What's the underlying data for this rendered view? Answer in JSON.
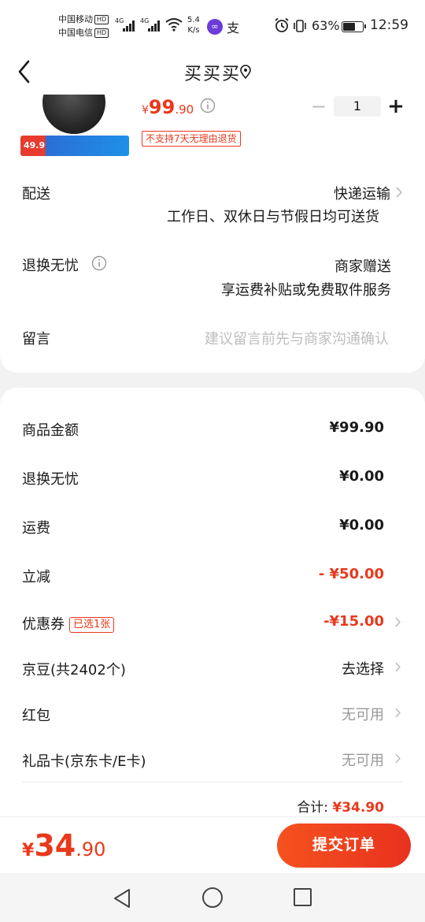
{
  "status_bar": {
    "carrier1": "中国移动",
    "carrier2": "中国电信",
    "hd": "HD",
    "net": "4G",
    "speed_value": "5.4",
    "speed_unit": "K/s",
    "battery": "63%",
    "time": "12:59",
    "battery_level_percent": 63
  },
  "header": {
    "title": "买买买"
  },
  "product": {
    "banner_price": "49.9",
    "price_symbol": "¥",
    "price_int": "99",
    "price_dec": ".90",
    "quantity": "1",
    "minus": "−",
    "plus": "+",
    "no_return_tag": "不支持7天无理由退货"
  },
  "delivery": {
    "label": "配送",
    "method": "快递运输",
    "note": "工作日、双休日与节假日均可送货"
  },
  "return_worry_free": {
    "label": "退换无忧",
    "value": "商家赠送",
    "note": "享运费补贴或免费取件服务"
  },
  "message": {
    "label": "留言",
    "placeholder": "建议留言前先与商家沟通确认"
  },
  "fees": {
    "goods_amount_label": "商品金额",
    "goods_amount": "¥99.90",
    "return_label": "退换无忧",
    "return_amount": "¥0.00",
    "shipping_label": "运费",
    "shipping_amount": "¥0.00",
    "discount_label": "立减",
    "discount_amount": "- ¥50.00",
    "coupon_label": "优惠券",
    "coupon_badge": "已选1张",
    "coupon_amount": "-¥15.00",
    "jingdou_label": "京豆(共2402个)",
    "jingdou_value": "去选择",
    "redpacket_label": "红包",
    "redpacket_value": "无可用",
    "giftcard_label": "礼品卡(京东卡/E卡)",
    "giftcard_value": "无可用",
    "total_label": "合计:",
    "total_value": "¥34.90"
  },
  "bottom_bar": {
    "price_symbol": "¥",
    "price_int": "34",
    "price_dec": ".90",
    "submit_label": "提交订单"
  },
  "colors": {
    "accent_red": "#e8391d",
    "submit_gradient_start": "#f5521f",
    "submit_gradient_end": "#e8321f",
    "page_bg": "#f2f2f2"
  },
  "icons": {
    "back": "chevron-left-icon",
    "location": "location-pin-icon",
    "info": "info-circle-icon",
    "chevron": "chevron-right-icon",
    "alarm": "alarm-icon",
    "vibrate": "vibrate-icon",
    "wifi": "wifi-icon"
  }
}
